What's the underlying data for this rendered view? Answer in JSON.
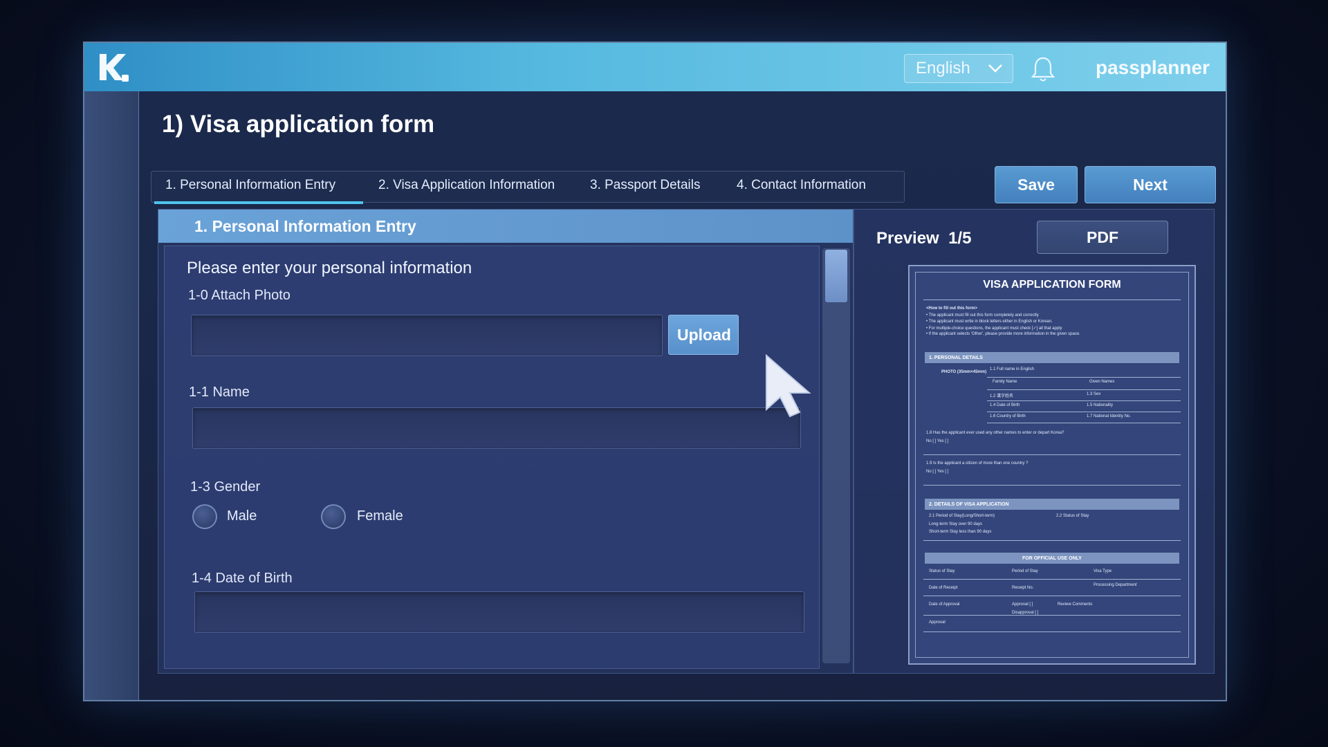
{
  "app": {
    "username": "passplanner",
    "language": "English"
  },
  "page": {
    "title": "1) Visa application form"
  },
  "tabs": [
    {
      "label": "1. Personal Information Entry"
    },
    {
      "label": "2. Visa Application Information"
    },
    {
      "label": "3. Passport Details"
    },
    {
      "label": "4. Contact Information"
    }
  ],
  "actions": {
    "save": "Save",
    "next": "Next"
  },
  "form": {
    "header": "1. Personal Information Entry",
    "intro": "Please enter your personal information",
    "photo_label": "1-0 Attach Photo",
    "upload_label": "Upload",
    "name_label": "1-1 Name",
    "gender_label": "1-3 Gender",
    "gender_options": [
      "Male",
      "Female"
    ],
    "dob_label": "1-4 Date of Birth"
  },
  "preview": {
    "title": "Preview",
    "page_indicator": "1/5",
    "pdf_label": "PDF",
    "doc_title": "VISA APPLICATION FORM",
    "doc_instructions_heading": "<How to fill out this form>",
    "doc_instructions": [
      "• The applicant must fill out this form completely and correctly",
      "• The applicant must write in block letters either in English or Korean.",
      "• For multiple-choice questions, the applicant must check [✓] all that apply",
      "• If the applicant selects 'Other', please provide more information in the given space."
    ],
    "sections": [
      "1. PERSONAL DETAILS",
      "2. DETAILS OF VISA APPLICATION",
      "FOR OFFICIAL USE ONLY"
    ],
    "personal_fields": [
      "PHOTO (35mm×45mm)",
      "1.1 Full name in English",
      "Family Name",
      "Given Names",
      "1.2 漢字姓名",
      "1.3 Sex",
      "1.4 Date of Birth",
      "1.5 Nationality",
      "1.6 Country of Birth",
      "1.7 National Identity No."
    ],
    "questions": [
      "1.8 Has the applicant ever used any other names to enter or depart Korea?",
      "No [   ]      Yes [   ]",
      "1.9 Is the applicant a citizen of more than one country ?",
      "No [   ]      Yes [   ]"
    ],
    "visa_fields": [
      "2.1 Period of Stay(Long/Short-term)",
      "2.2 Status of Stay",
      "Long-term Stay over 90 days",
      "Short-term Stay less than 90 days"
    ],
    "official_fields": [
      "Status of Stay",
      "Period of Stay",
      "Visa Type",
      "Date of Receipt",
      "Receipt No.",
      "Processing Department",
      "Date of Approval",
      "Approval [   ]",
      "Disapproval [   ]",
      "Review Comments",
      "Approval"
    ]
  }
}
